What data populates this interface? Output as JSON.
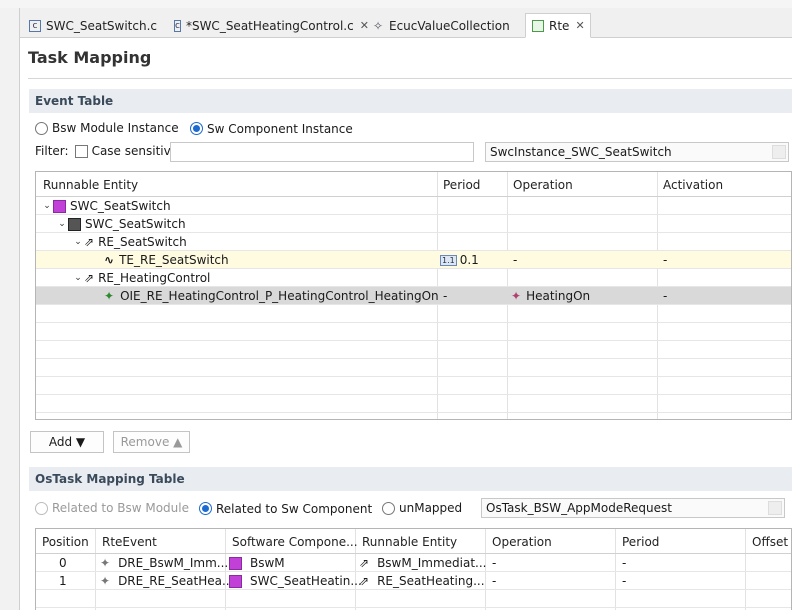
{
  "tabs": [
    {
      "label": "SWC_SeatSwitch.c",
      "icon": "c-file-icon",
      "active": false
    },
    {
      "label": "*SWC_SeatHeatingControl.c",
      "icon": "c-file-icon",
      "active": false,
      "closable": true
    },
    {
      "label": "EcucValueCollection",
      "icon": "ecuc-icon",
      "active": false
    },
    {
      "label": "Rte",
      "icon": "rte-icon",
      "active": true,
      "closable": true
    }
  ],
  "page_title": "Task Mapping",
  "event_table": {
    "title": "Event Table",
    "radio_bsw": "Bsw Module Instance",
    "radio_sw": "Sw Component Instance",
    "filter_label": "Filter:",
    "case_label": "Case sensitive",
    "filter_value": "",
    "instance_value": "SwcInstance_SWC_SeatSwitch",
    "columns": [
      "Runnable Entity",
      "Period",
      "Operation",
      "Activation"
    ],
    "rows": [
      {
        "name": "SWC_SeatSwitch",
        "icon": "swc-instance-icon",
        "period": "",
        "operation": "",
        "activation": ""
      },
      {
        "name": "SWC_SeatSwitch",
        "icon": "component-icon",
        "period": "",
        "operation": "",
        "activation": ""
      },
      {
        "name": "RE_SeatSwitch",
        "icon": "runnable-icon",
        "period": "",
        "operation": "",
        "activation": ""
      },
      {
        "name": "TE_RE_SeatSwitch",
        "icon": "timing-event-icon",
        "period": "0.1",
        "operation": "-",
        "activation": "-"
      },
      {
        "name": "RE_HeatingControl",
        "icon": "runnable-icon",
        "period": "",
        "operation": "",
        "activation": ""
      },
      {
        "name": "OIE_RE_HeatingControl_P_HeatingControl_HeatingOn",
        "icon": "operation-event-icon",
        "period": "-",
        "operation": "HeatingOn",
        "activation": "-"
      }
    ],
    "add_label": "Add ▼",
    "remove_label": "Remove ▲"
  },
  "ostask_table": {
    "title": "OsTask Mapping Table",
    "radio_bsw": "Related to Bsw Module",
    "radio_sw": "Related to Sw Component",
    "radio_unmapped": "unMapped",
    "task_value": "OsTask_BSW_AppModeRequest",
    "columns": [
      "Position",
      "RteEvent",
      "Software Compone...",
      "Runnable Entity",
      "Operation",
      "Period",
      "Offset"
    ],
    "rows": [
      {
        "position": "0",
        "event": "DRE_BswM_Imm...",
        "component": "BswM",
        "runnable": "BswM_Immediat...",
        "operation": "-",
        "period": "-"
      },
      {
        "position": "1",
        "event": "DRE_RE_SeatHea...",
        "component": "SWC_SeatHeatin...",
        "runnable": "RE_SeatHeating...",
        "operation": "-",
        "period": "-"
      }
    ]
  },
  "colors": {
    "accent": "#1c6bd1",
    "highlight_row": "#fffbe0",
    "selected_row": "#d9d9d9",
    "section_bg": "#e9edf1",
    "swc_icon": "#c040d8"
  }
}
